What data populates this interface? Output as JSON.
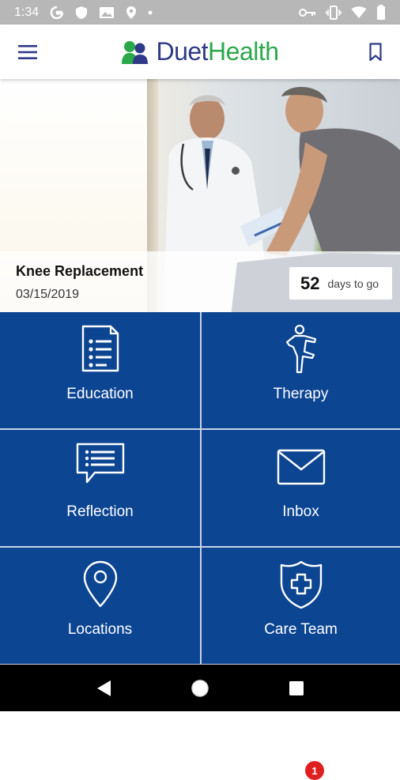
{
  "status_bar": {
    "time": "1:34",
    "icons_left": [
      "google-icon",
      "shield-icon",
      "image-icon",
      "location-icon",
      "dot-icon"
    ],
    "icons_right": [
      "key-icon",
      "vibrate-icon",
      "wifi-icon",
      "battery-icon"
    ]
  },
  "header": {
    "brand_duet": "Duet",
    "brand_health": "Health",
    "menu_icon": "hamburger-menu-icon",
    "bookmark_icon": "bookmark-icon",
    "colors": {
      "brand_blue": "#2e3a87",
      "brand_green": "#2aa84a"
    }
  },
  "hero": {
    "title": "Knee Replacement",
    "date": "03/15/2019",
    "days_count": "52",
    "days_label": "days to go"
  },
  "tiles": [
    {
      "label": "Education",
      "icon": "document-list-icon"
    },
    {
      "label": "Therapy",
      "icon": "person-exercise-icon"
    },
    {
      "label": "Reflection",
      "icon": "chat-list-icon"
    },
    {
      "label": "Inbox",
      "icon": "envelope-icon",
      "badge": "1"
    },
    {
      "label": "Locations",
      "icon": "map-pin-icon"
    },
    {
      "label": "Care Team",
      "icon": "shield-cross-icon"
    }
  ],
  "nav": {
    "back": "back-triangle-icon",
    "home": "home-circle-icon",
    "recents": "recents-square-icon"
  },
  "colors": {
    "tile_blue": "#0c4592",
    "badge_red": "#e02020"
  }
}
